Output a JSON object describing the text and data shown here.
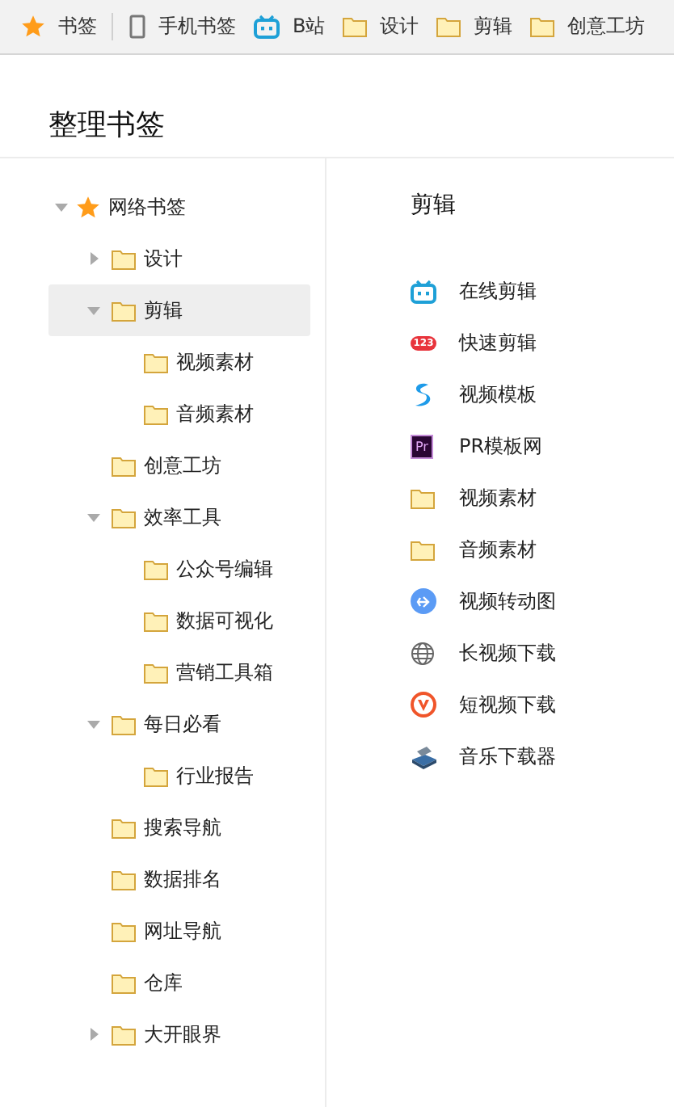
{
  "bookmarks_bar": [
    {
      "label": "书签",
      "kind": "star"
    },
    {
      "label": "手机书签",
      "kind": "phone"
    },
    {
      "label": "B站",
      "kind": "tv"
    },
    {
      "label": "设计",
      "kind": "folder"
    },
    {
      "label": "剪辑",
      "kind": "folder"
    },
    {
      "label": "创意工坊",
      "kind": "folder"
    }
  ],
  "page_title": "整理书签",
  "tree": [
    {
      "label": "网络书签",
      "kind": "root",
      "expanded": true,
      "selected": false,
      "children": [
        {
          "label": "设计",
          "kind": "folder",
          "expanded": false,
          "selected": false
        },
        {
          "label": "剪辑",
          "kind": "folder",
          "expanded": true,
          "selected": true,
          "children": [
            {
              "label": "视频素材",
              "kind": "folder",
              "selected": false
            },
            {
              "label": "音频素材",
              "kind": "folder",
              "selected": false
            }
          ]
        },
        {
          "label": "创意工坊",
          "kind": "folder",
          "selected": false
        },
        {
          "label": "效率工具",
          "kind": "folder",
          "expanded": true,
          "selected": false,
          "children": [
            {
              "label": "公众号编辑",
              "kind": "folder",
              "selected": false
            },
            {
              "label": "数据可视化",
              "kind": "folder",
              "selected": false
            },
            {
              "label": "营销工具箱",
              "kind": "folder",
              "selected": false
            }
          ]
        },
        {
          "label": "每日必看",
          "kind": "folder",
          "expanded": true,
          "selected": false,
          "children": [
            {
              "label": "行业报告",
              "kind": "folder",
              "selected": false
            }
          ]
        },
        {
          "label": "搜索导航",
          "kind": "folder",
          "selected": false
        },
        {
          "label": "数据排名",
          "kind": "folder",
          "selected": false
        },
        {
          "label": "网址导航",
          "kind": "folder",
          "selected": false
        },
        {
          "label": "仓库",
          "kind": "folder",
          "selected": false
        },
        {
          "label": "大开眼界",
          "kind": "folder",
          "expanded": false,
          "selected": false
        }
      ]
    }
  ],
  "folder_view": {
    "title": "剪辑",
    "items": [
      {
        "label": "在线剪辑",
        "kind": "tv"
      },
      {
        "label": "快速剪辑",
        "kind": "badge",
        "icon_text": "123"
      },
      {
        "label": "视频模板",
        "kind": "swirl"
      },
      {
        "label": "PR模板网",
        "kind": "pr",
        "icon_text": "Pr"
      },
      {
        "label": "视频素材",
        "kind": "folder"
      },
      {
        "label": "音频素材",
        "kind": "folder"
      },
      {
        "label": "视频转动图",
        "kind": "share"
      },
      {
        "label": "长视频下载",
        "kind": "globe"
      },
      {
        "label": "短视频下载",
        "kind": "v"
      },
      {
        "label": "音乐下载器",
        "kind": "player"
      }
    ]
  }
}
